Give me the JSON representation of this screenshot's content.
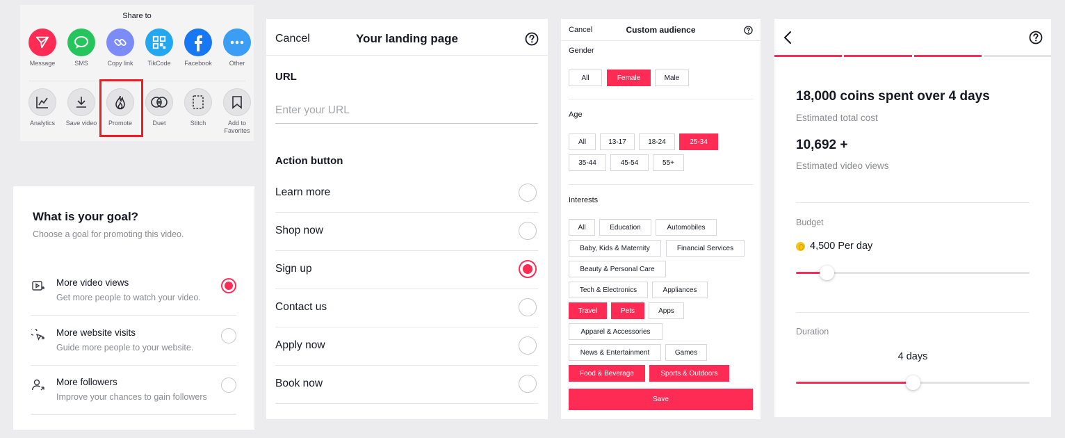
{
  "colors": {
    "accent": "#fe2c55",
    "highlight": "#ee1d23"
  },
  "share": {
    "title": "Share to",
    "row1": [
      {
        "label": "Message",
        "icon": "send-icon",
        "color": "#fe2c55"
      },
      {
        "label": "SMS",
        "icon": "chat-bubble-icon",
        "color": "#26c45c"
      },
      {
        "label": "Copy link",
        "icon": "link-icon",
        "color": "#7b8cf7"
      },
      {
        "label": "TikCode",
        "icon": "qr-code-icon",
        "color": "#23a7ee"
      },
      {
        "label": "Facebook",
        "icon": "facebook-icon",
        "color": "#1877f2"
      },
      {
        "label": "Other",
        "icon": "more-dots-icon",
        "color": "#3c9df4"
      }
    ],
    "row2": [
      {
        "label": "Analytics",
        "icon": "analytics-icon"
      },
      {
        "label": "Save video",
        "icon": "download-icon"
      },
      {
        "label": "Promote",
        "icon": "flame-icon"
      },
      {
        "label": "Duet",
        "icon": "duet-icon"
      },
      {
        "label": "Stitch",
        "icon": "stitch-icon"
      },
      {
        "label": "Add to\nFavorites",
        "icon": "bookmark-icon"
      }
    ]
  },
  "goal": {
    "title": "What is your goal?",
    "subtitle": "Choose a goal for promoting this video.",
    "options": [
      {
        "title": "More video views",
        "desc": "Get more people to watch your video.",
        "selected": true,
        "icon": "video-play-icon"
      },
      {
        "title": "More website visits",
        "desc": "Guide more people to your website.",
        "selected": false,
        "icon": "cursor-click-icon"
      },
      {
        "title": "More followers",
        "desc": "Improve your chances to gain followers",
        "selected": false,
        "icon": "person-add-icon"
      }
    ]
  },
  "landing": {
    "cancel": "Cancel",
    "title": "Your landing page",
    "url_label": "URL",
    "url_placeholder": "Enter your URL",
    "action_label": "Action button",
    "options": [
      {
        "label": "Learn more",
        "selected": false
      },
      {
        "label": "Shop now",
        "selected": false
      },
      {
        "label": "Sign up",
        "selected": true
      },
      {
        "label": "Contact us",
        "selected": false
      },
      {
        "label": "Apply now",
        "selected": false
      },
      {
        "label": "Book now",
        "selected": false
      }
    ]
  },
  "audience": {
    "cancel": "Cancel",
    "title": "Custom audience",
    "gender_label": "Gender",
    "gender": [
      {
        "label": "All",
        "selected": false
      },
      {
        "label": "Female",
        "selected": true
      },
      {
        "label": "Male",
        "selected": false
      }
    ],
    "age_label": "Age",
    "age": [
      {
        "label": "All",
        "selected": false
      },
      {
        "label": "13-17",
        "selected": false
      },
      {
        "label": "18-24",
        "selected": false
      },
      {
        "label": "25-34",
        "selected": true
      },
      {
        "label": "35-44",
        "selected": false
      },
      {
        "label": "45-54",
        "selected": false
      },
      {
        "label": "55+",
        "selected": false
      }
    ],
    "interests_label": "Interests",
    "interests": [
      {
        "label": "All",
        "selected": false
      },
      {
        "label": "Education",
        "selected": false
      },
      {
        "label": "Automobiles",
        "selected": false
      },
      {
        "label": "Baby, Kids & Maternity",
        "selected": false
      },
      {
        "label": "Financial Services",
        "selected": false
      },
      {
        "label": "Beauty & Personal Care",
        "selected": false
      },
      {
        "label": "Tech & Electronics",
        "selected": false
      },
      {
        "label": "Appliances",
        "selected": false
      },
      {
        "label": "Travel",
        "selected": true
      },
      {
        "label": "Pets",
        "selected": true
      },
      {
        "label": "Apps",
        "selected": false
      },
      {
        "label": "Apparel & Accessories",
        "selected": false
      },
      {
        "label": "News & Entertainment",
        "selected": false
      },
      {
        "label": "Games",
        "selected": false
      },
      {
        "label": "Food & Beverage",
        "selected": true
      },
      {
        "label": "Sports & Outdoors",
        "selected": true
      }
    ],
    "save": "Save"
  },
  "budget": {
    "steps_completed": 3,
    "steps_total": 4,
    "coins_summary": "18,000 coins spent over 4 days",
    "coins_sub": "Estimated total cost",
    "views": "10,692 +",
    "views_sub": "Estimated video views",
    "budget_label": "Budget",
    "budget_amount": "4,500 Per day",
    "budget_slider_fraction": 0.13,
    "duration_label": "Duration",
    "duration_value": "4 days",
    "duration_slider_fraction": 0.5
  }
}
